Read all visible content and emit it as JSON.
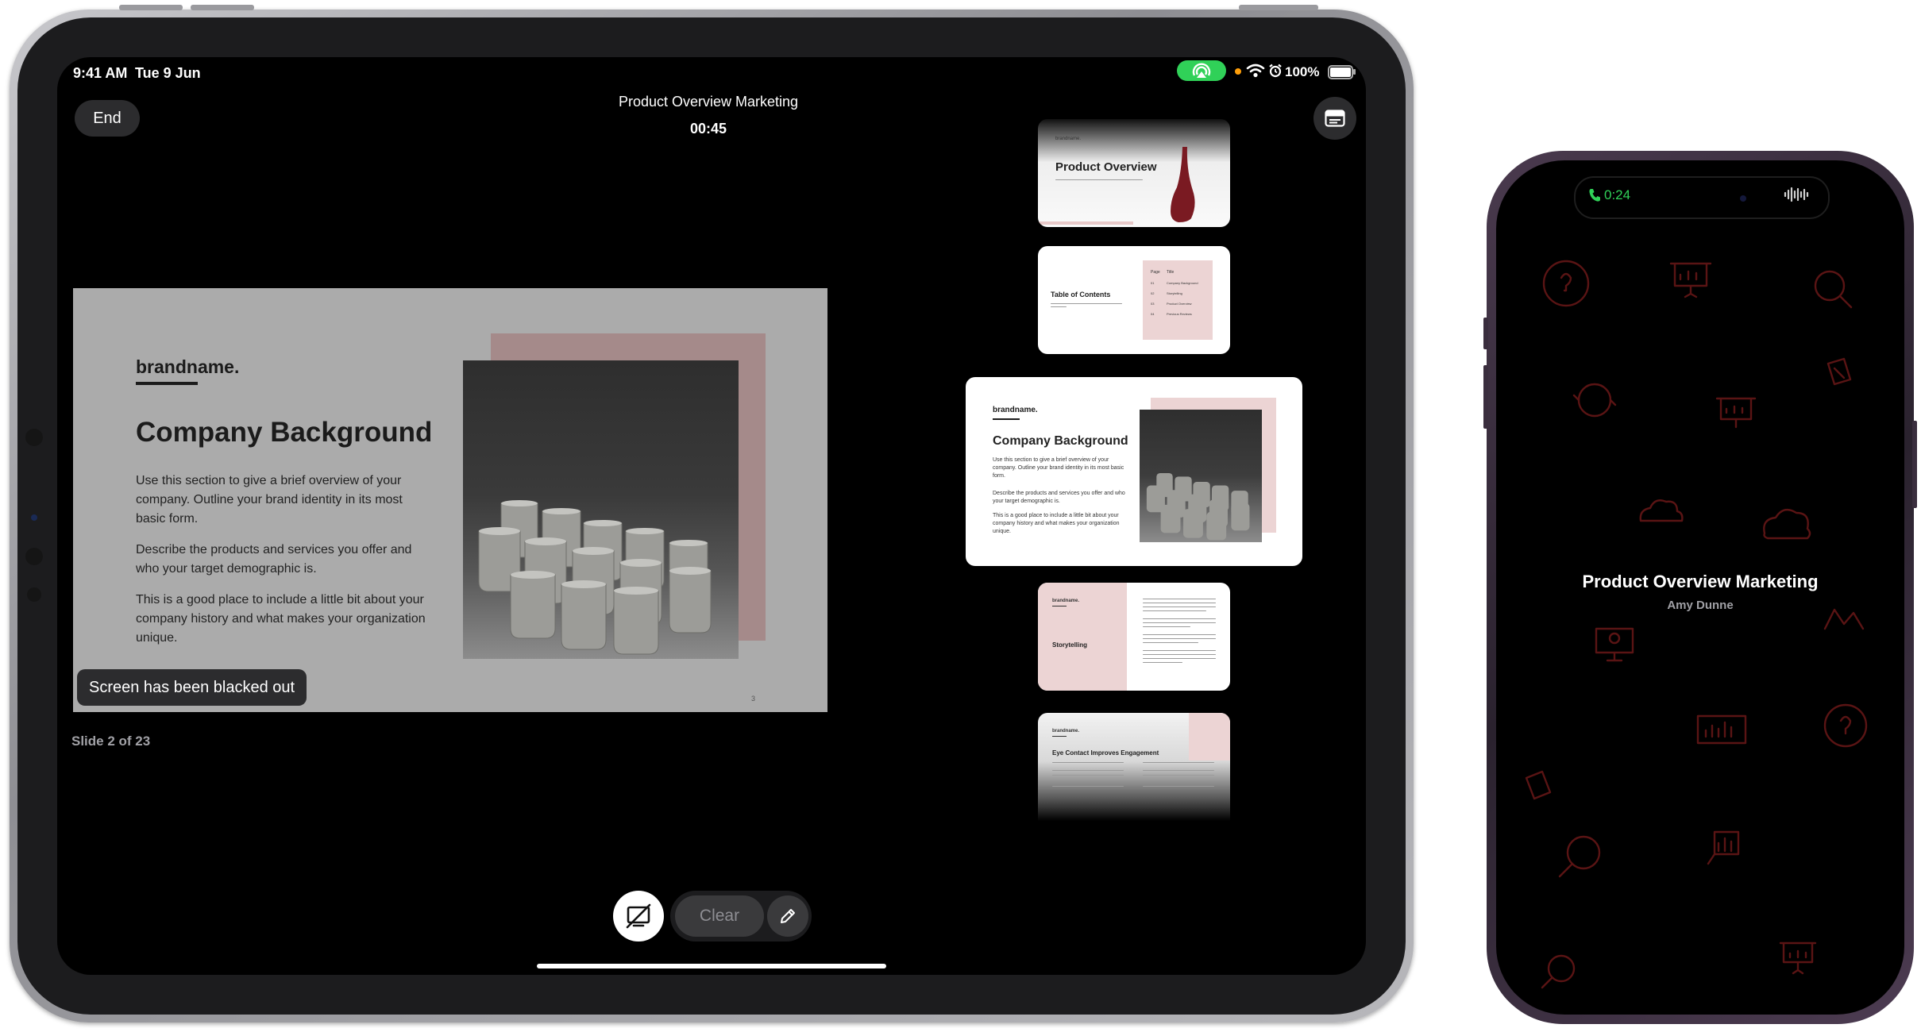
{
  "ipad": {
    "status_bar": {
      "time": "9:41 AM",
      "date": "Tue 9 Jun",
      "battery": "100%"
    },
    "end_button": "End",
    "presentation_title": "Product Overview Marketing",
    "timer": "00:45",
    "slide_counter": "Slide 2 of 23",
    "blackout_toast": "Screen has been blacked out",
    "toolbar": {
      "clear_label": "Clear"
    },
    "current_slide": {
      "brand": "brandname.",
      "title": "Company Background",
      "paragraphs": [
        "Use this section to give a brief overview of your company. Outline your brand identity in its most basic form.",
        "Describe the products and services you offer and who your target demographic is.",
        "This is a good place to include a little bit about your company history and what makes your organization unique."
      ],
      "page_number": "3"
    },
    "thumbnails": [
      {
        "title": "Product Overview",
        "brand": "brandname."
      },
      {
        "title": "Table of Contents",
        "col1": "Page",
        "col2": "Title",
        "rows": [
          "01",
          "02",
          "03",
          "04"
        ],
        "items": [
          "Company Background",
          "Storytelling",
          "Product Overview",
          "Previous Reviews"
        ]
      },
      {
        "title": "Company Background",
        "brand": "brandname."
      },
      {
        "title": "Storytelling",
        "brand": "brandname."
      },
      {
        "title": "Eye Contact Improves Engagement",
        "brand": "brandname."
      }
    ]
  },
  "iphone": {
    "call_time": "0:24",
    "title": "Product Overview Marketing",
    "presenter": "Amy Dunne"
  },
  "colors": {
    "call_green": "#30d158",
    "slide_bg": "#ababab",
    "accent_pink": "#e8c9c9",
    "icon_red": "#5a1414"
  }
}
